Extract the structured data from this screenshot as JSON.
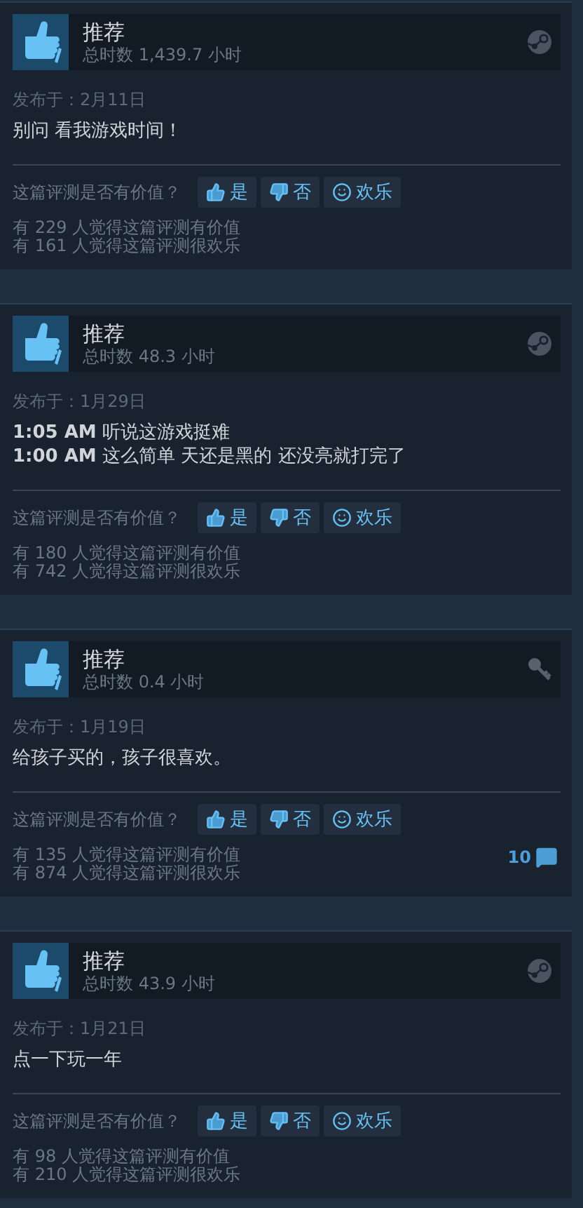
{
  "reviews": [
    {
      "verdict": "推荐",
      "hours": "总时数 1,439.7 小时",
      "source_icon": {
        "kind": "logo"
      },
      "posted": "发布于：2月11日",
      "body": [
        "别问 看我游戏时间！"
      ],
      "helpful_prompt": "这篇评测是否有价值？",
      "buttons": [
        {
          "kind": "yes",
          "label": "是"
        },
        {
          "kind": "no",
          "label": "否"
        },
        {
          "kind": "funny",
          "label": "欢乐"
        }
      ],
      "stats": [
        "有 229 人觉得这篇评测有价值",
        "有 161 人觉得这篇评测很欢乐"
      ]
    },
    {
      "verdict": "推荐",
      "hours": "总时数 48.3 小时",
      "source_icon": {
        "kind": "logo"
      },
      "posted": "发布于：1月29日",
      "body": [
        "**1:05 AM** 听说这游戏挺难",
        "**1:00 AM** 这么简单 天还是黑的 还没亮就打完了"
      ],
      "helpful_prompt": "这篇评测是否有价值？",
      "buttons": [
        {
          "kind": "yes",
          "label": "是"
        },
        {
          "kind": "no",
          "label": "否"
        },
        {
          "kind": "funny",
          "label": "欢乐"
        }
      ],
      "stats": [
        "有 180 人觉得这篇评测有价值",
        "有 742 人觉得这篇评测很欢乐"
      ]
    },
    {
      "verdict": "推荐",
      "hours": "总时数 0.4 小时",
      "source_icon": {
        "kind": "key"
      },
      "posted": "发布于：1月19日",
      "body": [
        "给孩子买的，孩子很喜欢。"
      ],
      "helpful_prompt": "这篇评测是否有价值？",
      "buttons": [
        {
          "kind": "yes",
          "label": "是"
        },
        {
          "kind": "no",
          "label": "否"
        },
        {
          "kind": "funny",
          "label": "欢乐"
        }
      ],
      "stats": [
        "有 135 人觉得这篇评测有价值",
        "有 874 人觉得这篇评测很欢乐"
      ],
      "comments": "10"
    },
    {
      "verdict": "推荐",
      "hours": "总时数 43.9 小时",
      "source_icon": {
        "kind": "logo"
      },
      "posted": "发布于：1月21日",
      "body": [
        "点一下玩一年"
      ],
      "helpful_prompt": "这篇评测是否有价值？",
      "buttons": [
        {
          "kind": "yes",
          "label": "是"
        },
        {
          "kind": "no",
          "label": "否"
        },
        {
          "kind": "funny",
          "label": "欢乐"
        }
      ],
      "stats": [
        "有 98 人觉得这篇评测有价值",
        "有 210 人觉得这篇评测很欢乐"
      ]
    }
  ]
}
